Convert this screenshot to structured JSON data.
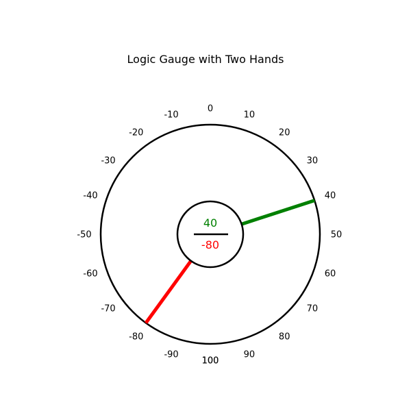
{
  "chart_data": {
    "type": "gauge",
    "title": "Logic Gauge with Two Hands",
    "scale_min": -100,
    "scale_max": 100,
    "tick_step": 10,
    "ticks": [
      {
        "value": 0,
        "label": "0"
      },
      {
        "value": 10,
        "label": "10"
      },
      {
        "value": 20,
        "label": "20"
      },
      {
        "value": 30,
        "label": "30"
      },
      {
        "value": 40,
        "label": "40"
      },
      {
        "value": 50,
        "label": "50"
      },
      {
        "value": 60,
        "label": "60"
      },
      {
        "value": 70,
        "label": "70"
      },
      {
        "value": 80,
        "label": "80"
      },
      {
        "value": 90,
        "label": "90"
      },
      {
        "value": 100,
        "label": "100"
      },
      {
        "value": -10,
        "label": "-10"
      },
      {
        "value": -20,
        "label": "-20"
      },
      {
        "value": -30,
        "label": "-30"
      },
      {
        "value": -40,
        "label": "-40"
      },
      {
        "value": -50,
        "label": "-50"
      },
      {
        "value": -60,
        "label": "-60"
      },
      {
        "value": -70,
        "label": "-70"
      },
      {
        "value": -80,
        "label": "-80"
      },
      {
        "value": -90,
        "label": "-90"
      },
      {
        "value": -100,
        "label": "100"
      }
    ],
    "hands": [
      {
        "value": 40,
        "label": "40",
        "color": "#008000"
      },
      {
        "value": -80,
        "label": "-80",
        "color": "#ff0000"
      }
    ]
  }
}
